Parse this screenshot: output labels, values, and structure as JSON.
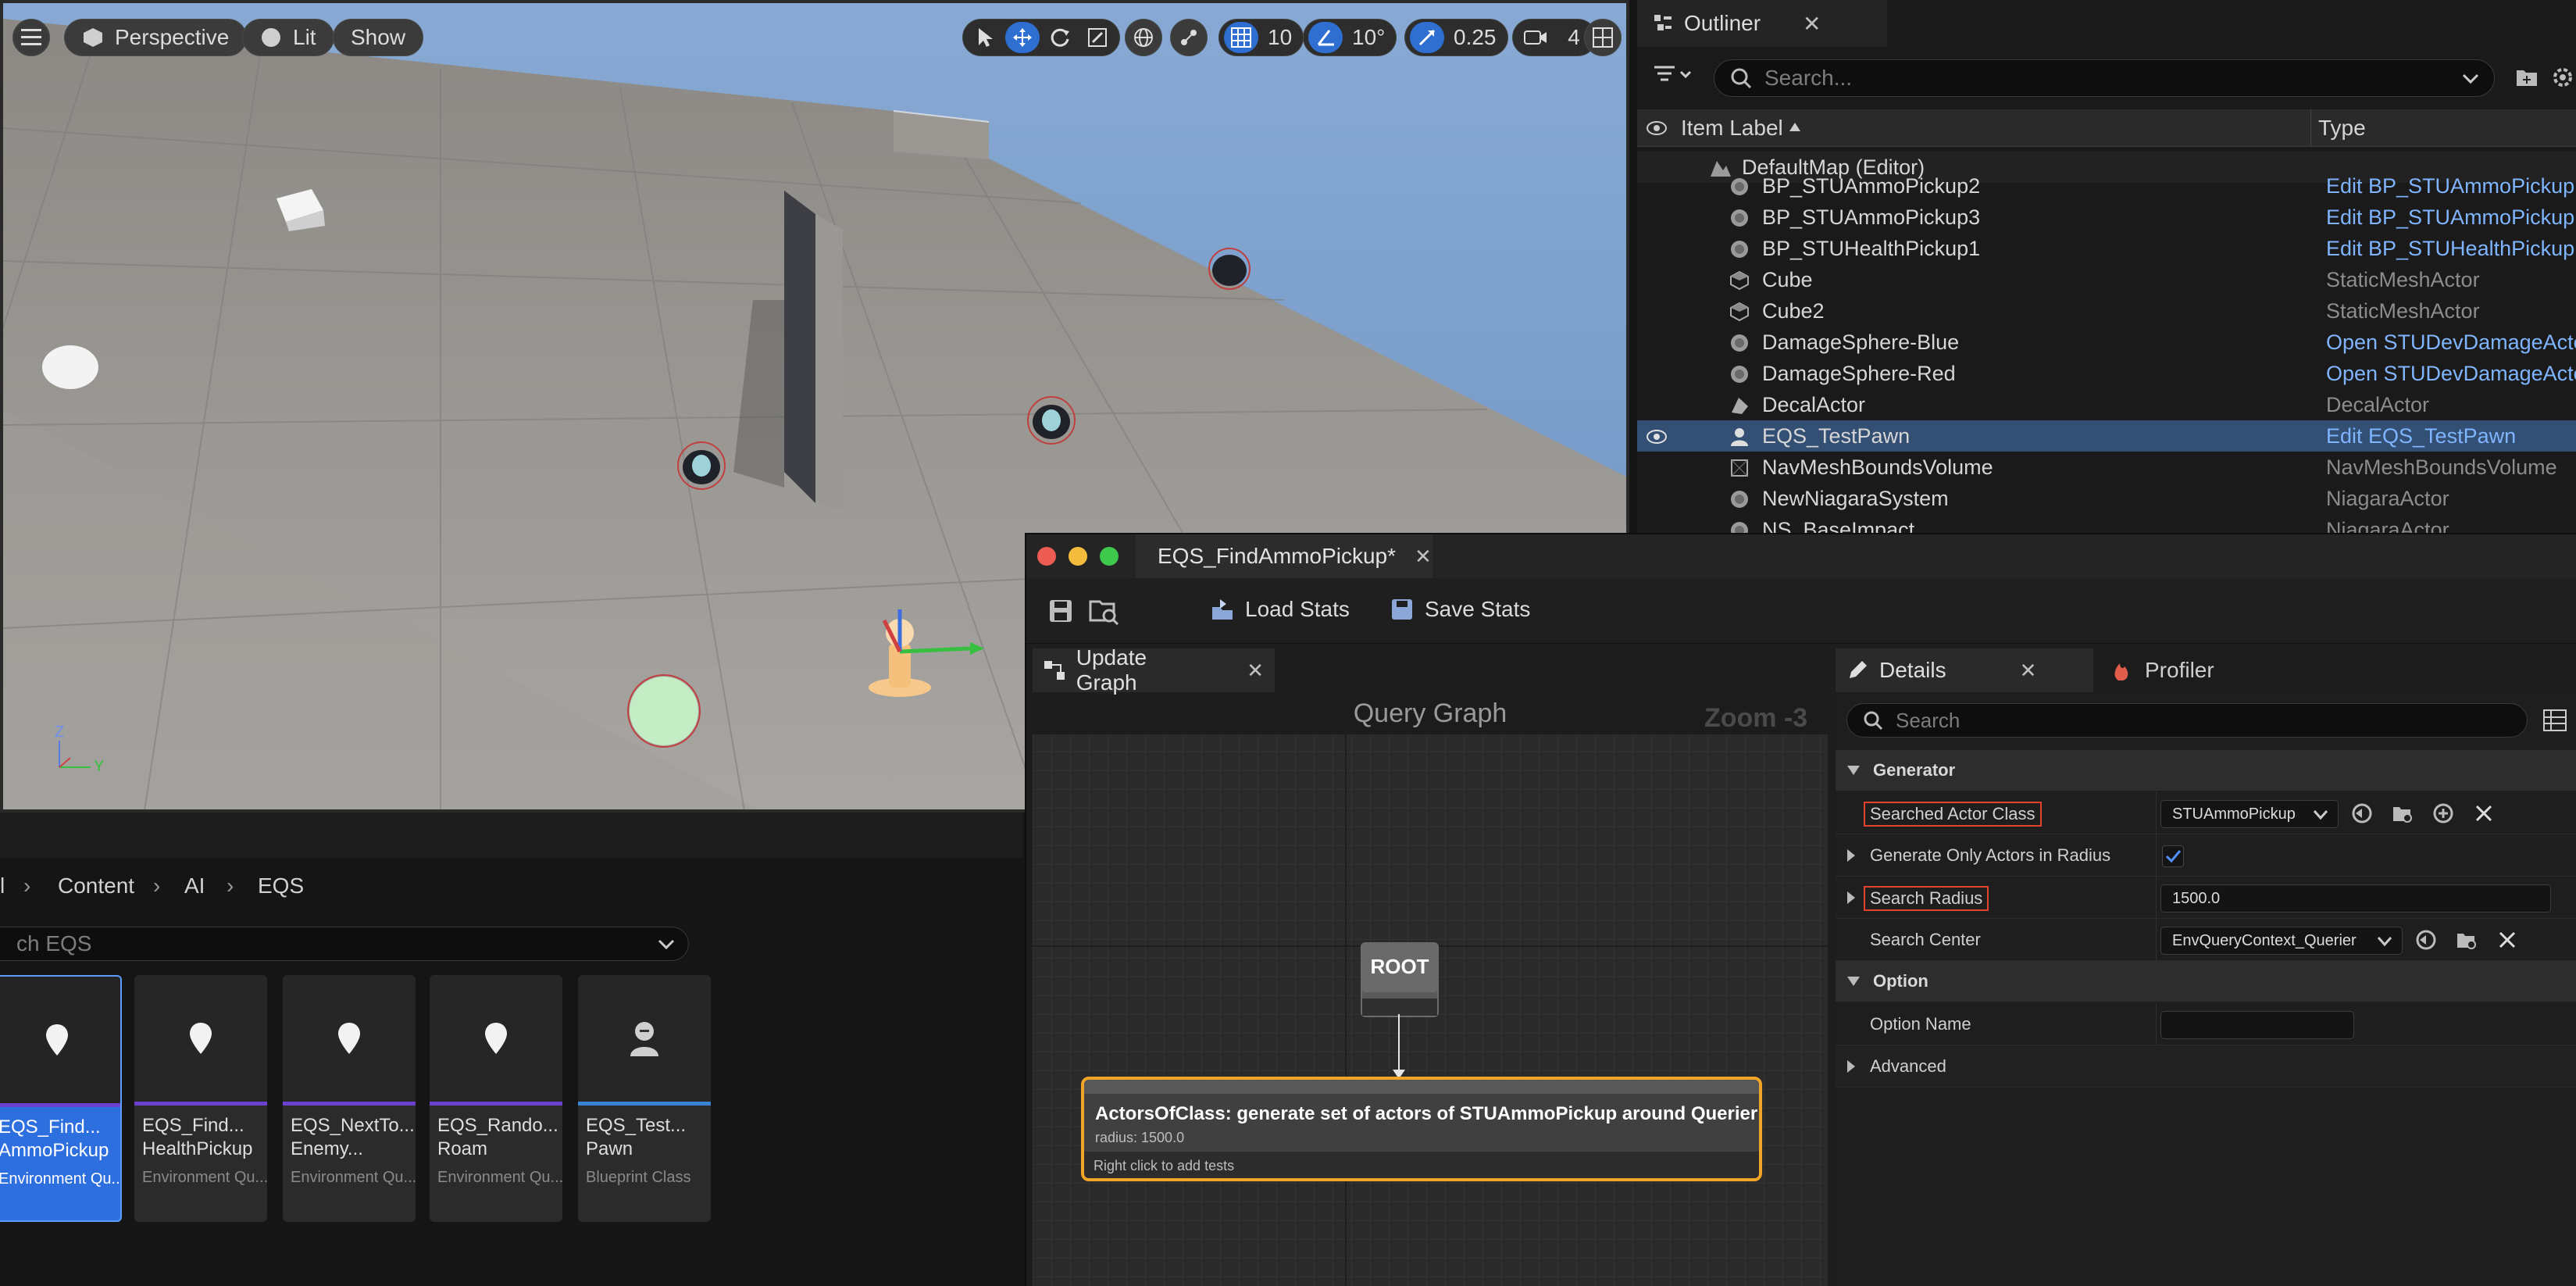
{
  "viewport": {
    "view_mode": "Perspective",
    "lighting": "Lit",
    "show": "Show",
    "grid_snap": "10",
    "rotation_snap": "10°",
    "scale_snap": "0.25",
    "camera_speed": "4",
    "axis_z": "Z",
    "axis_y": "Y"
  },
  "outliner": {
    "tab_label": "Outliner",
    "search_placeholder": "Search...",
    "col_label": "Item Label",
    "col_type": "Type",
    "map_name": "DefaultMap (Editor)",
    "rows": [
      {
        "name": "BP_STUAmmoPickup2",
        "type": "Edit BP_STUAmmoPickup"
      },
      {
        "name": "BP_STUAmmoPickup3",
        "type": "Edit BP_STUAmmoPickup"
      },
      {
        "name": "BP_STUHealthPickup1",
        "type": "Edit BP_STUHealthPickup"
      },
      {
        "name": "Cube",
        "type": "StaticMeshActor"
      },
      {
        "name": "Cube2",
        "type": "StaticMeshActor"
      },
      {
        "name": "DamageSphere-Blue",
        "type": "Open STUDevDamageActor"
      },
      {
        "name": "DamageSphere-Red",
        "type": "Open STUDevDamageActor"
      },
      {
        "name": "DecalActor",
        "type": "DecalActor"
      },
      {
        "name": "EQS_TestPawn",
        "type": "Edit EQS_TestPawn"
      },
      {
        "name": "NavMeshBoundsVolume",
        "type": "NavMeshBoundsVolume"
      },
      {
        "name": "NewNiagaraSystem",
        "type": "NiagaraActor"
      },
      {
        "name": "NS_BaseImpact",
        "type": "NiagaraActor"
      }
    ]
  },
  "content_browser": {
    "breadcrumb": [
      "l",
      "Content",
      "AI",
      "EQS"
    ],
    "search_placeholder": "ch EQS",
    "assets": [
      {
        "name": "EQS_Find... AmmoPickup",
        "type": "Environment Qu..."
      },
      {
        "name": "EQS_Find... HealthPickup",
        "type": "Environment Qu..."
      },
      {
        "name": "EQS_NextTo... Enemy...",
        "type": "Environment Qu..."
      },
      {
        "name": "EQS_Rando... Roam",
        "type": "Environment Qu..."
      },
      {
        "name": "EQS_Test... Pawn",
        "type": "Blueprint Class"
      }
    ]
  },
  "eqs_editor": {
    "title": "EQS_FindAmmoPickup*",
    "load_stats": "Load Stats",
    "save_stats": "Save Stats",
    "update_graph_tab": "Update Graph",
    "graph_title": "Query Graph",
    "zoom": "Zoom -3",
    "root_label": "ROOT",
    "generator_node": {
      "title": "ActorsOfClass: generate set of actors of STUAmmoPickup around Querier",
      "detail": "radius: 1500.0",
      "hint": "Right click to add tests"
    },
    "details": {
      "tab_label": "Details",
      "profiler_label": "Profiler",
      "search_placeholder": "Search",
      "generator_category": "Generator",
      "searched_actor_class_label": "Searched Actor Class",
      "searched_actor_class_value": "STUAmmoPickup",
      "generate_only_label": "Generate Only Actors in Radius",
      "generate_only_checked": true,
      "search_radius_label": "Search Radius",
      "search_radius_value": "1500.0",
      "search_center_label": "Search Center",
      "search_center_value": "EnvQueryContext_Querier",
      "option_category": "Option",
      "option_name_label": "Option Name",
      "option_name_value": "",
      "advanced_category": "Advanced"
    }
  }
}
